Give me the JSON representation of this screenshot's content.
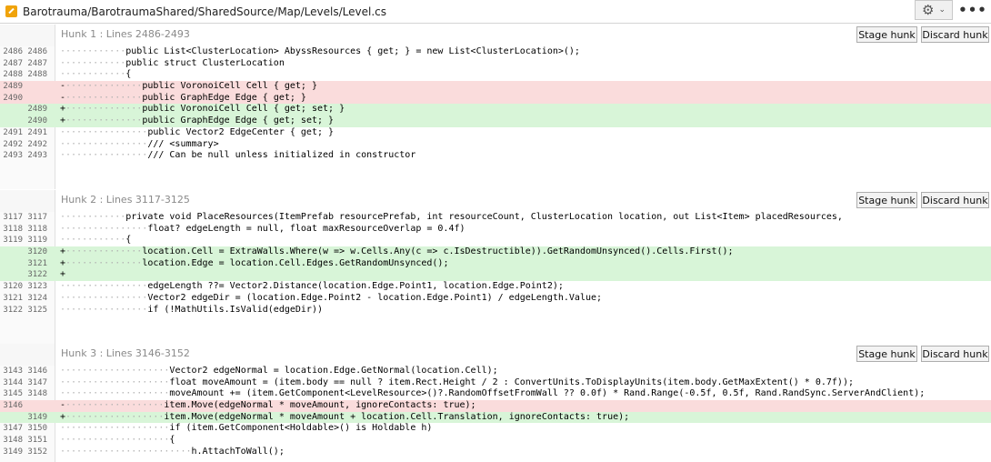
{
  "titlebar": {
    "file_path": "Barotrauma/BarotraumaShared/SharedSource/Map/Levels/Level.cs",
    "settings_icon": "gear-icon",
    "more_icon": "more-horizontal-icon"
  },
  "buttons": {
    "stage": "Stage hunk",
    "discard": "Discard hunk"
  },
  "hunks": [
    {
      "title": "Hunk 1 : Lines 2486-2493",
      "lines": [
        {
          "old": "2486",
          "new": "2486",
          "type": "ctx",
          "indent": "············",
          "code": "public List<ClusterLocation> AbyssResources { get; } = new List<ClusterLocation>();"
        },
        {
          "old": "2487",
          "new": "2487",
          "type": "ctx",
          "indent": "············",
          "code": "public struct ClusterLocation"
        },
        {
          "old": "2488",
          "new": "2488",
          "type": "ctx",
          "indent": "············",
          "code": "{"
        },
        {
          "old": "2489",
          "new": "",
          "type": "del",
          "indent": "···············",
          "code": "public VoronoiCell Cell { get; }"
        },
        {
          "old": "2490",
          "new": "",
          "type": "del",
          "indent": "···············",
          "code": "public GraphEdge Edge { get; }"
        },
        {
          "old": "",
          "new": "2489",
          "type": "add",
          "indent": "···············",
          "code": "public VoronoiCell Cell { get; set; }"
        },
        {
          "old": "",
          "new": "2490",
          "type": "add",
          "indent": "···············",
          "code": "public GraphEdge Edge { get; set; }"
        },
        {
          "old": "2491",
          "new": "2491",
          "type": "ctx",
          "indent": "················",
          "code": "public Vector2 EdgeCenter { get; }"
        },
        {
          "old": "2492",
          "new": "2492",
          "type": "ctx",
          "indent": "················",
          "code": "/// <summary>"
        },
        {
          "old": "2493",
          "new": "2493",
          "type": "ctx",
          "indent": "················",
          "code": "/// Can be null unless initialized in constructor"
        }
      ]
    },
    {
      "title": "Hunk 2 : Lines 3117-3125",
      "lines": [
        {
          "old": "3117",
          "new": "3117",
          "type": "ctx",
          "indent": "············",
          "code": "private void PlaceResources(ItemPrefab resourcePrefab, int resourceCount, ClusterLocation location, out List<Item> placedResources,"
        },
        {
          "old": "3118",
          "new": "3118",
          "type": "ctx",
          "indent": "················",
          "code": "float? edgeLength = null, float maxResourceOverlap = 0.4f)"
        },
        {
          "old": "3119",
          "new": "3119",
          "type": "ctx",
          "indent": "············",
          "code": "{"
        },
        {
          "old": "",
          "new": "3120",
          "type": "add",
          "indent": "···············",
          "code": "location.Cell = ExtraWalls.Where(w => w.Cells.Any(c => c.IsDestructible)).GetRandomUnsynced().Cells.First();"
        },
        {
          "old": "",
          "new": "3121",
          "type": "add",
          "indent": "···············",
          "code": "location.Edge = location.Cell.Edges.GetRandomUnsynced();"
        },
        {
          "old": "",
          "new": "3122",
          "type": "add",
          "indent": "",
          "code": ""
        },
        {
          "old": "3120",
          "new": "3123",
          "type": "ctx",
          "indent": "················",
          "code": "edgeLength ??= Vector2.Distance(location.Edge.Point1, location.Edge.Point2);"
        },
        {
          "old": "3121",
          "new": "3124",
          "type": "ctx",
          "indent": "················",
          "code": "Vector2 edgeDir = (location.Edge.Point2 - location.Edge.Point1) / edgeLength.Value;"
        },
        {
          "old": "3122",
          "new": "3125",
          "type": "ctx",
          "indent": "················",
          "code": "if (!MathUtils.IsValid(edgeDir))"
        }
      ]
    },
    {
      "title": "Hunk 3 : Lines 3146-3152",
      "lines": [
        {
          "old": "3143",
          "new": "3146",
          "type": "ctx",
          "indent": "····················",
          "code": "Vector2 edgeNormal = location.Edge.GetNormal(location.Cell);"
        },
        {
          "old": "3144",
          "new": "3147",
          "type": "ctx",
          "indent": "····················",
          "code": "float moveAmount = (item.body == null ? item.Rect.Height / 2 : ConvertUnits.ToDisplayUnits(item.body.GetMaxExtent() * 0.7f));"
        },
        {
          "old": "3145",
          "new": "3148",
          "type": "ctx",
          "indent": "····················",
          "code": "moveAmount += (item.GetComponent<LevelResource>()?.RandomOffsetFromWall ?? 0.0f) * Rand.Range(-0.5f, 0.5f, Rand.RandSync.ServerAndClient);"
        },
        {
          "old": "3146",
          "new": "",
          "type": "del",
          "indent": "···················",
          "code": "item.Move(edgeNormal * moveAmount, ignoreContacts: true);"
        },
        {
          "old": "",
          "new": "3149",
          "type": "add",
          "indent": "···················",
          "code": "item.Move(edgeNormal * moveAmount + location.Cell.Translation, ignoreContacts: true);"
        },
        {
          "old": "3147",
          "new": "3150",
          "type": "ctx",
          "indent": "····················",
          "code": "if (item.GetComponent<Holdable>() is Holdable h)"
        },
        {
          "old": "3148",
          "new": "3151",
          "type": "ctx",
          "indent": "····················",
          "code": "{"
        },
        {
          "old": "3149",
          "new": "3152",
          "type": "ctx",
          "indent": "························",
          "code": "h.AttachToWall();"
        }
      ]
    }
  ]
}
